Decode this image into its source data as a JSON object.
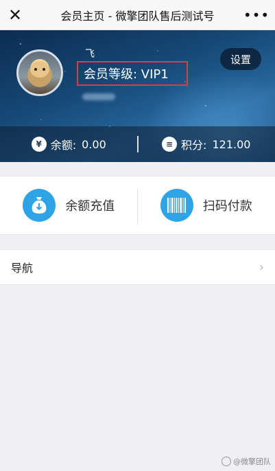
{
  "topbar": {
    "close_icon": "close-icon",
    "title": "会员主页 - 微擎团队售后测试号",
    "more_icon": "more-dots-icon",
    "close_glyph": "✕",
    "more_glyph": "•••"
  },
  "profile": {
    "nickname": "飞",
    "level_text": "会员等级: VIP1",
    "settings_label": "设置",
    "highlight_color": "#e23b3b"
  },
  "stats": {
    "balance": {
      "icon": "yen-icon",
      "icon_glyph": "¥",
      "label": "余额:",
      "value": "0.00"
    },
    "points": {
      "icon": "coins-icon",
      "icon_glyph": "≡",
      "label": "积分:",
      "value": "121.00"
    }
  },
  "actions": [
    {
      "icon": "money-bag-icon",
      "label": "余额充值"
    },
    {
      "icon": "barcode-icon",
      "label": "扫码付款"
    }
  ],
  "nav": {
    "label": "导航",
    "chevron_glyph": "›"
  },
  "watermark": "@微擎团队",
  "colors": {
    "accent_blue": "#2ea4e6",
    "hero_dark": "#0c2c52",
    "page_bg": "#efeff4"
  }
}
